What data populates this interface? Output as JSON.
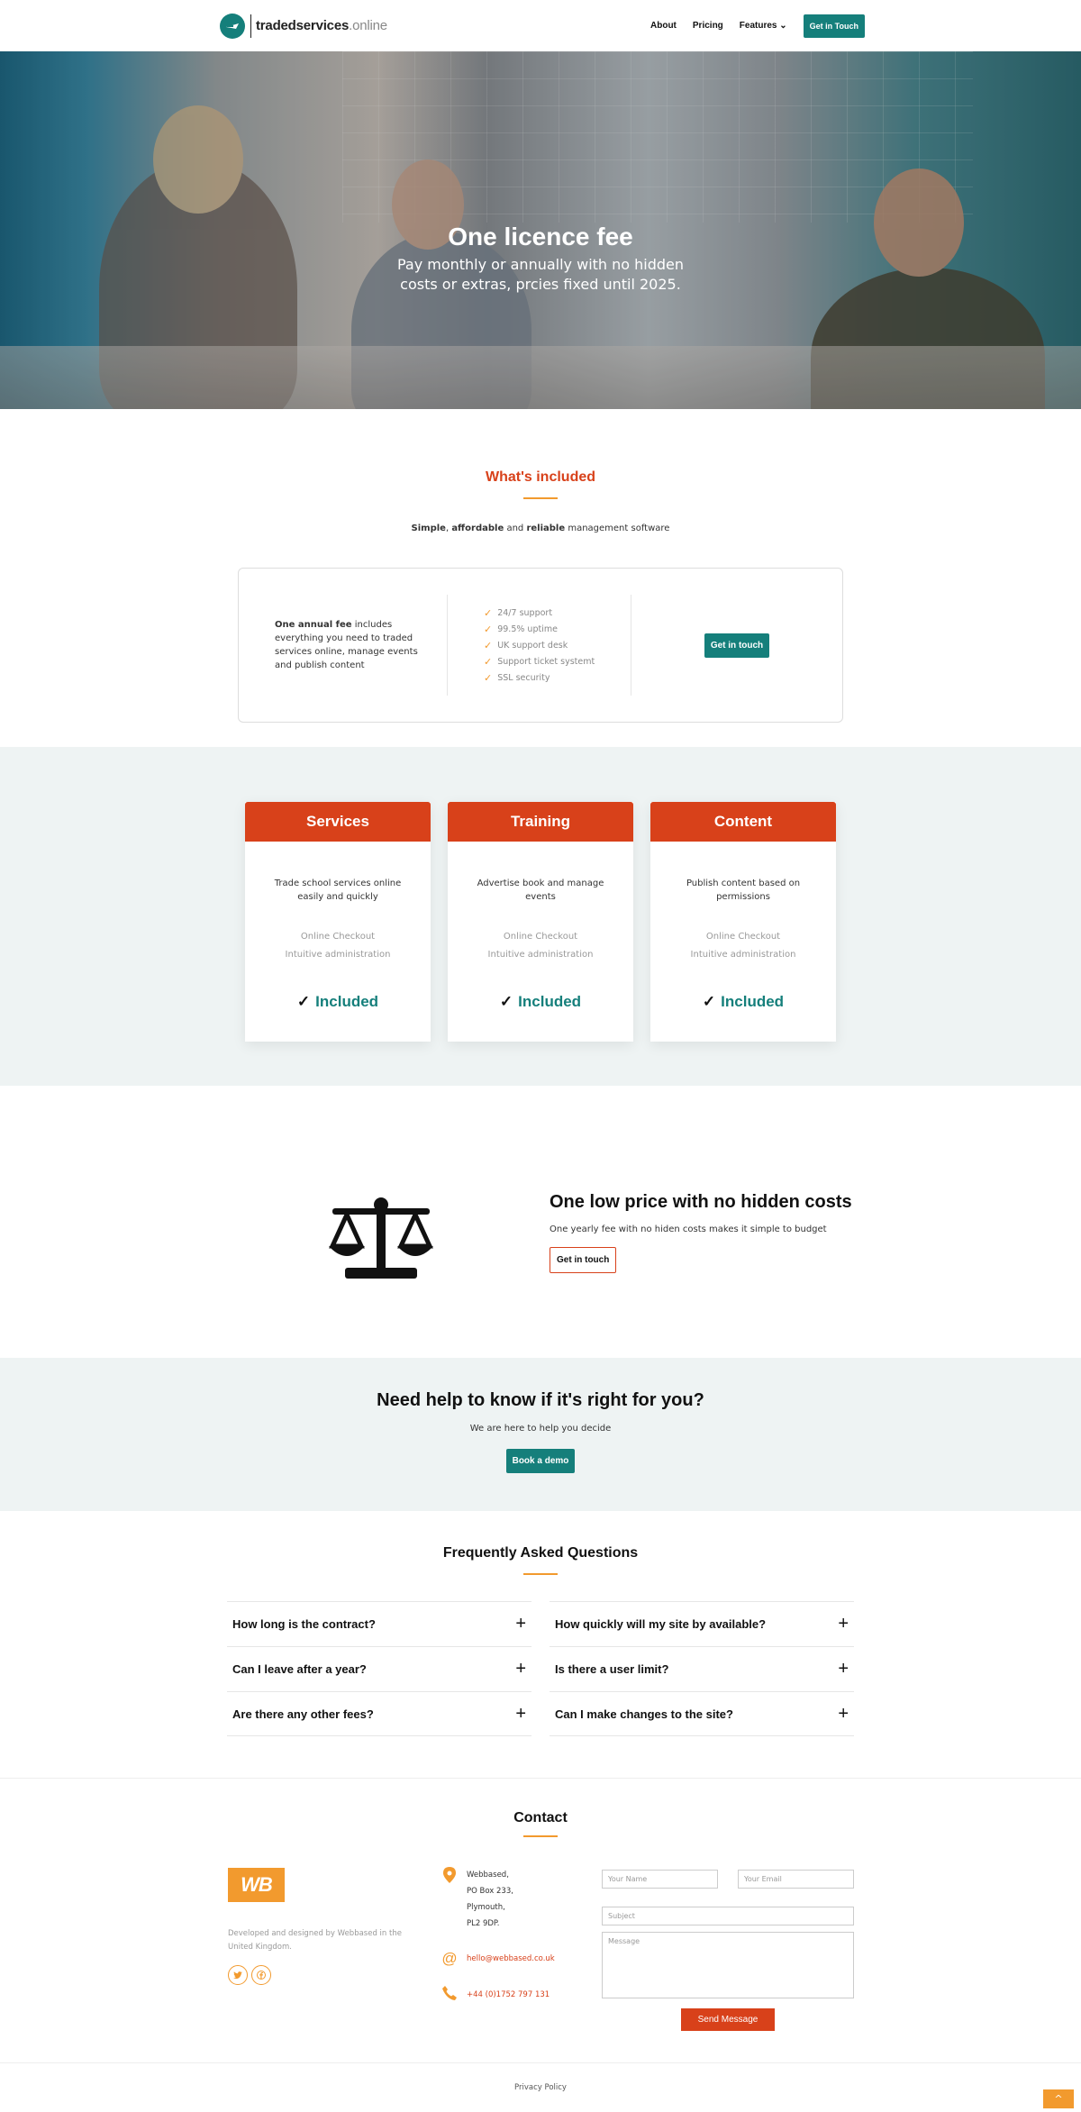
{
  "brand": {
    "name": "tradedservices",
    "tld": ".online"
  },
  "nav": {
    "about": "About",
    "pricing": "Pricing",
    "features": "Features",
    "cta": "Get in Touch"
  },
  "hero": {
    "title": "One licence fee",
    "subtitle": "Pay monthly or annually with no hidden costs or extras, prcies fixed until 2025."
  },
  "included": {
    "title": "What's included",
    "tagline": {
      "w1": "Simple",
      "w2": "affordable",
      "w3": "and",
      "w4": "reliable",
      "w5": "management software"
    },
    "intro_bold": "One annual fee",
    "intro_rest": "includes everything you need to traded services online, manage events and publish content",
    "features": [
      "24/7 support",
      "99.5% uptime",
      "UK support desk",
      "Support ticket systemt",
      "SSL security"
    ],
    "cta": "Get in touch"
  },
  "cards": [
    {
      "title": "Services",
      "desc": "Trade school services online easily and quickly",
      "f1": "Online Checkout",
      "f2": "Intuitive administration",
      "badge": "Included"
    },
    {
      "title": "Training",
      "desc": "Advertise book and manage events",
      "f1": "Online Checkout",
      "f2": "Intuitive administration",
      "badge": "Included"
    },
    {
      "title": "Content",
      "desc": "Publish content based on permissions",
      "f1": "Online Checkout",
      "f2": "Intuitive administration",
      "badge": "Included"
    }
  ],
  "price": {
    "t1": "One",
    "t2": "low price",
    "t3": "with",
    "t4": "no hidden costs",
    "sub": "One yearly fee with no hiden costs makes it simple to budget",
    "cta": "Get in touch"
  },
  "help": {
    "title": "Need help to know if it's right for you?",
    "sub": "We are here to help you decide",
    "cta": "Book a demo"
  },
  "faq": {
    "title": "Frequently Asked Questions",
    "left": [
      "How long is the contract?",
      "Can I leave after a year?",
      "Are there any other fees?"
    ],
    "right": [
      "How quickly will my site by available?",
      "Is there a user limit?",
      "Can I make changes to the site?"
    ]
  },
  "contact": {
    "title": "Contact",
    "logo": "WB",
    "desc": "Developed and designed by Webbased in the United Kingdom.",
    "address": [
      "Webbased,",
      "PO Box 233,",
      "Plymouth,",
      "PL2 9DP."
    ],
    "email": "hello@webbased.co.uk",
    "phone": "+44 (0)1752 797 131",
    "form": {
      "name": "Your Name",
      "email": "Your Email",
      "subject": "Subject",
      "message": "Message",
      "send": "Send Message"
    }
  },
  "footer": {
    "privacy": "Privacy Policy",
    "to_top": "^"
  },
  "colors": {
    "teal": "#157f7b",
    "orange_red": "#d8411a",
    "orange": "#f29a2e",
    "light_bg": "#eef3f3"
  }
}
